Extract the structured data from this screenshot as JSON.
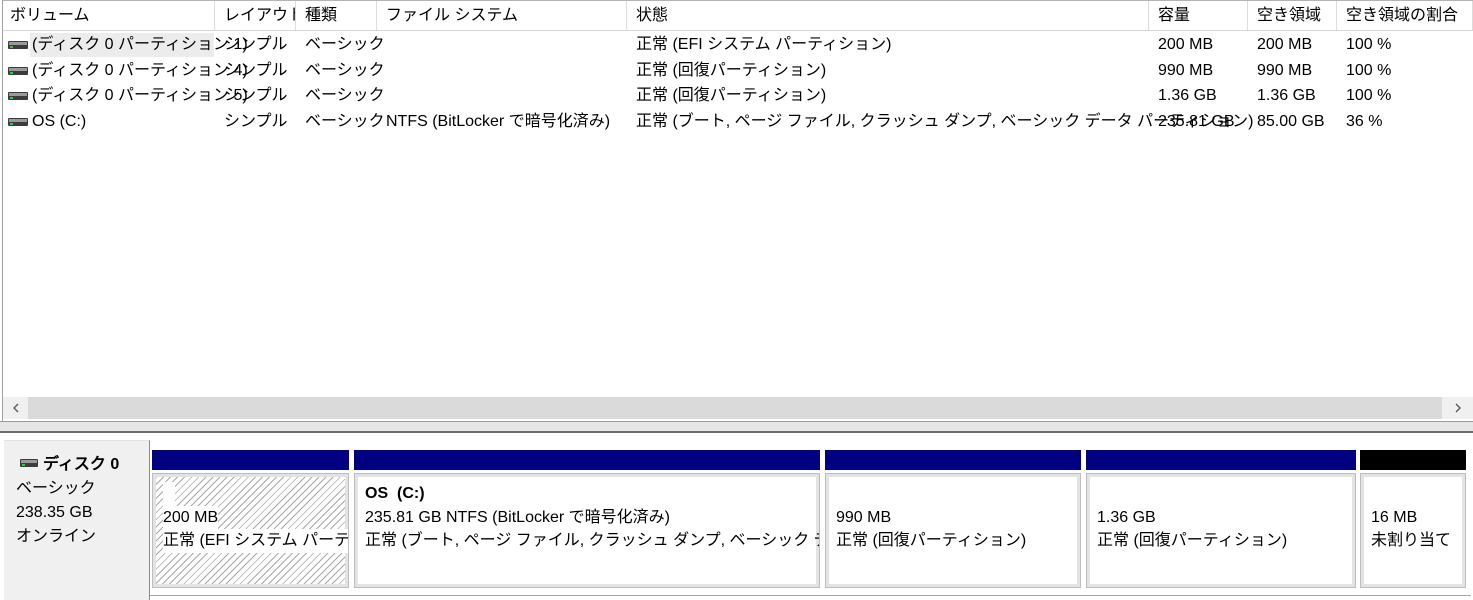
{
  "columns": [
    {
      "key": "volume",
      "label": "ボリューム"
    },
    {
      "key": "layout",
      "label": "レイアウト"
    },
    {
      "key": "type",
      "label": "種類"
    },
    {
      "key": "filesystem",
      "label": "ファイル システム"
    },
    {
      "key": "status",
      "label": "状態"
    },
    {
      "key": "capacity",
      "label": "容量"
    },
    {
      "key": "free_space",
      "label": "空き領域"
    },
    {
      "key": "free_percent",
      "label": "空き領域の割合"
    }
  ],
  "volumes": [
    {
      "icon": "drive-icon",
      "volume": "(ディスク 0 パーティション 1)",
      "layout": "シンプル",
      "type": "ベーシック",
      "status": "正常 (EFI システム パーティション)",
      "capacity": "200 MB",
      "free_space": "200 MB",
      "free_percent": "100 %",
      "focused": true
    },
    {
      "icon": "drive-icon",
      "volume": "(ディスク 0 パーティション 4)",
      "layout": "シンプル",
      "type": "ベーシック",
      "status": "正常 (回復パーティション)",
      "capacity": "990 MB",
      "free_space": "990 MB",
      "free_percent": "100 %"
    },
    {
      "icon": "drive-icon",
      "volume": "(ディスク 0 パーティション 5)",
      "layout": "シンプル",
      "type": "ベーシック",
      "status": "正常 (回復パーティション)",
      "capacity": "1.36 GB",
      "free_space": "1.36 GB",
      "free_percent": "100 %"
    },
    {
      "icon": "drive-icon",
      "volume": "OS (C:)",
      "layout": "シンプル",
      "type": "ベーシック",
      "filesystem": "NTFS (BitLocker で暗号化済み)",
      "status": "正常 (ブート, ページ ファイル, クラッシュ ダンプ, ベーシック データ パーティション)",
      "capacity": "235.81 GB",
      "free_space": "85.00 GB",
      "free_percent": "36 %"
    }
  ],
  "scrollbar": {
    "left_icon": "chevron-left-icon",
    "right_icon": "chevron-right-icon"
  },
  "disk": {
    "icon": "disk-icon",
    "name": "ディスク 0",
    "type": "ベーシック",
    "size": "238.35 GB",
    "status": "オンライン"
  },
  "partitions": [
    {
      "size": "200 MB",
      "status": "正常 (EFI システム パーティ",
      "bar_color": "#000080",
      "selected": true
    },
    {
      "name": "OS  (C:)",
      "size": "235.81 GB NTFS (BitLocker で暗号化済み)",
      "status": "正常 (ブート, ページ ファイル, クラッシュ ダンプ, ベーシック データ パーテ",
      "bar_color": "#000080"
    },
    {
      "size": "990 MB",
      "status": "正常 (回復パーティション)",
      "bar_color": "#000080"
    },
    {
      "size": "1.36 GB",
      "status": "正常 (回復パーティション)",
      "bar_color": "#000080"
    },
    {
      "size": "16 MB",
      "status": "未割り当て",
      "bar_color": "#000000"
    }
  ]
}
